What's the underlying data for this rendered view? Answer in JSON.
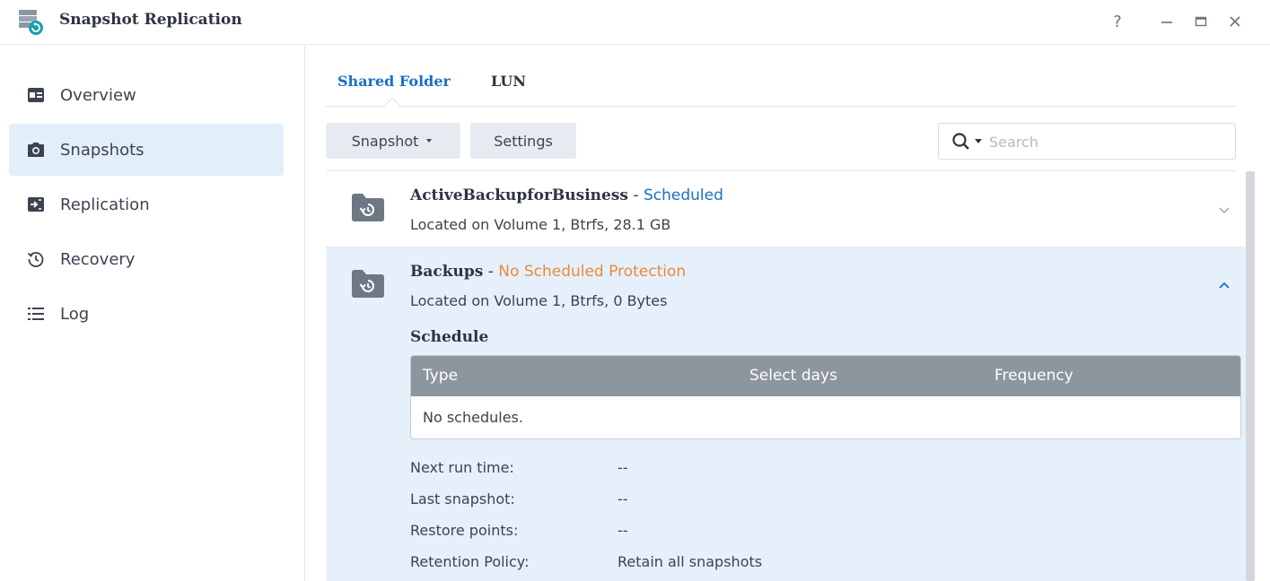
{
  "app": {
    "title": "Snapshot Replication",
    "icon": "app-database-icon"
  },
  "window_controls": {
    "help": "?",
    "minimize": "—",
    "maximize": "▭",
    "close": "✕"
  },
  "sidebar": {
    "items": [
      {
        "label": "Overview",
        "icon": "overview-icon",
        "active": false
      },
      {
        "label": "Snapshots",
        "icon": "camera-icon",
        "active": true
      },
      {
        "label": "Replication",
        "icon": "replication-icon",
        "active": false
      },
      {
        "label": "Recovery",
        "icon": "recovery-icon",
        "active": false
      },
      {
        "label": "Log",
        "icon": "list-icon",
        "active": false
      }
    ]
  },
  "tabs": [
    {
      "label": "Shared Folder",
      "active": true
    },
    {
      "label": "LUN",
      "active": false
    }
  ],
  "toolbar": {
    "snapshot_label": "Snapshot",
    "settings_label": "Settings"
  },
  "search": {
    "placeholder": "Search",
    "value": ""
  },
  "folders": [
    {
      "name": "ActiveBackupforBusiness",
      "separator": " - ",
      "status": "Scheduled",
      "status_color": "#1a6fc8",
      "location": "Located on Volume 1, Btrfs, 28.1 GB",
      "expanded": false
    },
    {
      "name": "Backups",
      "separator": " - ",
      "status": "No Scheduled Protection",
      "status_color": "#e88a3a",
      "location": "Located on Volume 1, Btrfs, 0 Bytes",
      "expanded": true,
      "details": {
        "schedule_title": "Schedule",
        "schedule_columns": [
          "Type",
          "Select days",
          "Frequency"
        ],
        "schedule_empty": "No schedules.",
        "info": [
          {
            "label": "Next run time:",
            "value": "--"
          },
          {
            "label": "Last snapshot:",
            "value": "--"
          },
          {
            "label": "Restore points:",
            "value": "--"
          },
          {
            "label": "Retention Policy:",
            "value": "Retain all snapshots"
          }
        ]
      }
    }
  ],
  "colors": {
    "accent": "#1a6fc8",
    "active_nav_bg": "#e3eefb",
    "expanded_row_bg": "#e6f0fb",
    "table_header_bg": "#8d959f",
    "warning": "#e88a3a"
  }
}
